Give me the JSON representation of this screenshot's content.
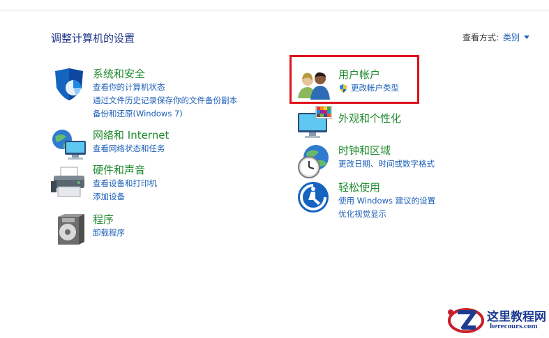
{
  "header": {
    "title": "调整计算机的设置",
    "view_by_label": "查看方式:",
    "view_by_value": "类别"
  },
  "left_column": [
    {
      "key": "system_security",
      "title": "系统和安全",
      "icon": "shield-icon",
      "links": [
        "查看你的计算机状态",
        "通过文件历史记录保存你的文件备份副本",
        "备份和还原(Windows 7)"
      ]
    },
    {
      "key": "network",
      "title": "网络和 Internet",
      "icon": "network-globe-icon",
      "links": [
        "查看网络状态和任务"
      ]
    },
    {
      "key": "hardware",
      "title": "硬件和声音",
      "icon": "printer-icon",
      "links": [
        "查看设备和打印机",
        "添加设备"
      ]
    },
    {
      "key": "programs",
      "title": "程序",
      "icon": "programs-disc-icon",
      "links": [
        "卸载程序"
      ]
    }
  ],
  "right_column": [
    {
      "key": "user_accounts",
      "title": "用户帐户",
      "icon": "users-icon",
      "links": [
        "更改帐户类型"
      ],
      "link_icon": "uac-shield-icon"
    },
    {
      "key": "appearance",
      "title": "外观和个性化",
      "icon": "monitor-palette-icon",
      "links": []
    },
    {
      "key": "clock_region",
      "title": "时钟和区域",
      "icon": "clock-globe-icon",
      "links": [
        "更改日期、时间或数字格式"
      ]
    },
    {
      "key": "ease_of_access",
      "title": "轻松使用",
      "icon": "ease-of-access-icon",
      "links": [
        "使用 Windows 建议的设置",
        "优化视觉显示"
      ]
    }
  ],
  "watermark": {
    "cn": "这里教程网",
    "en": "herecours.com"
  },
  "colors": {
    "category_title": "#1f8a2e",
    "link": "#1d5fb8",
    "highlight": "#e0101a"
  }
}
